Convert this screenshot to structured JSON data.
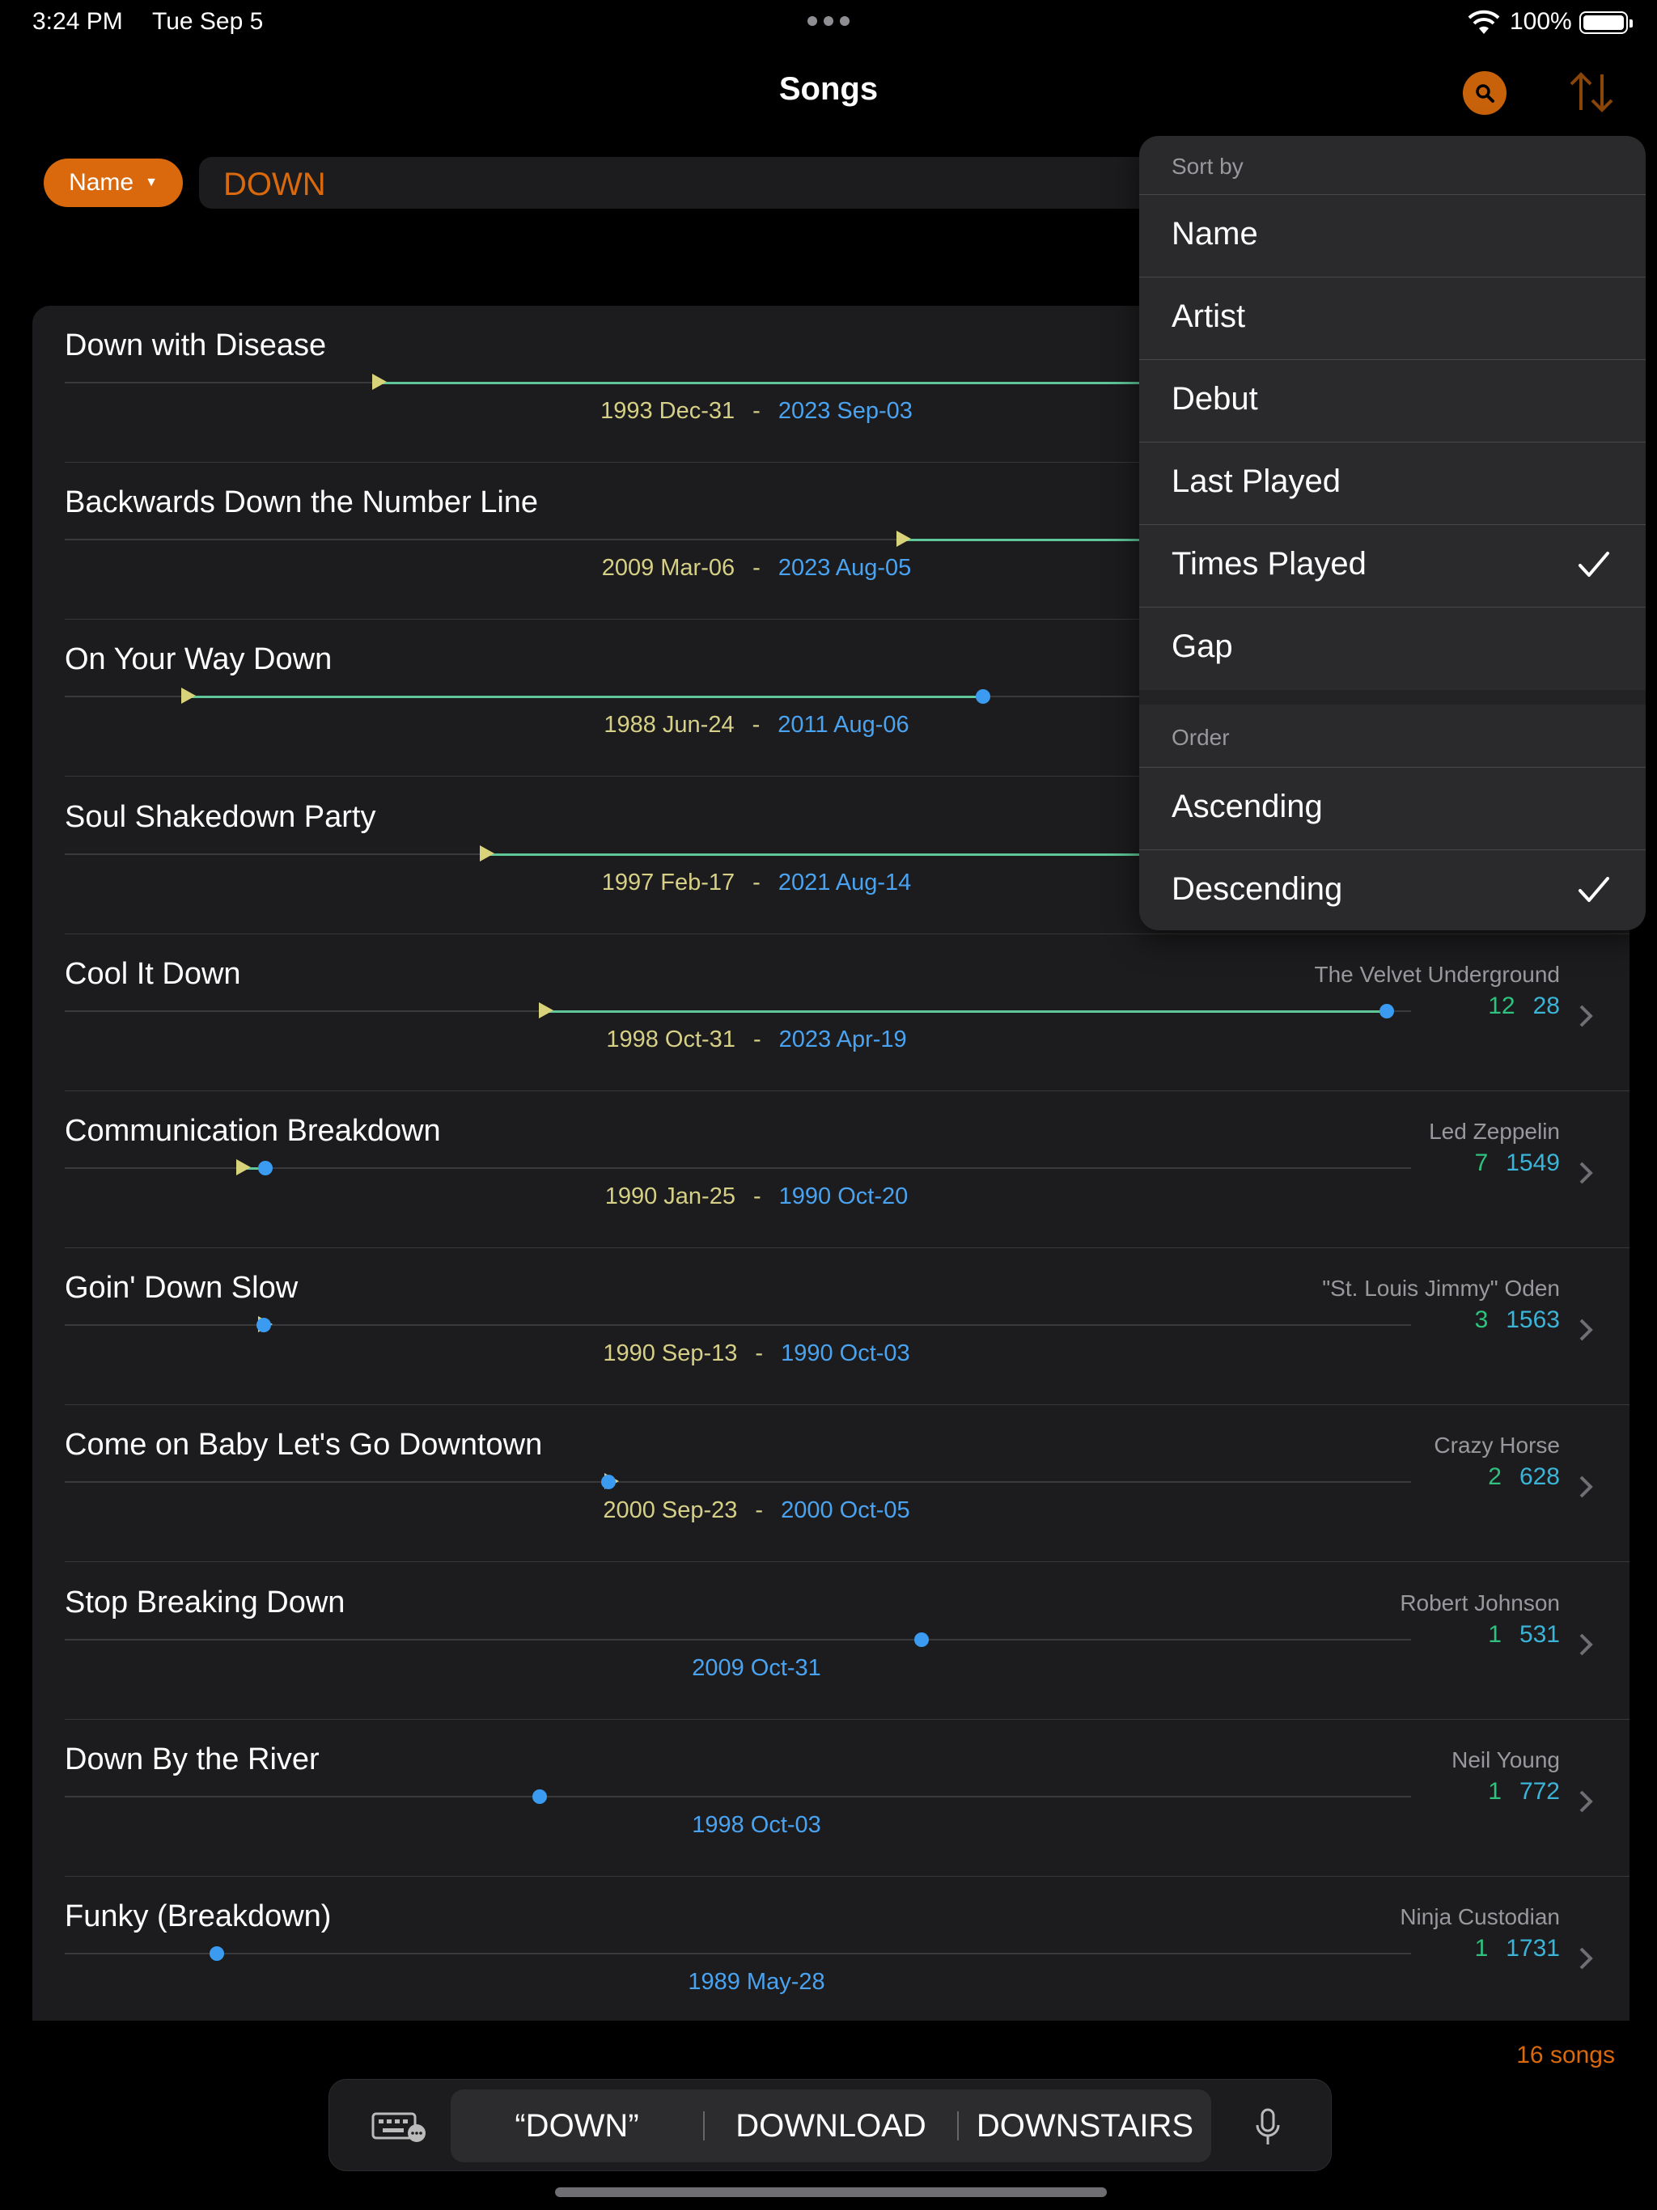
{
  "status": {
    "time": "3:24 PM",
    "date": "Tue Sep 5",
    "battery": "100%"
  },
  "nav": {
    "title": "Songs",
    "search_icon": "search-icon",
    "sort_icon": "sort-arrows-icon"
  },
  "filter": {
    "field_label": "Name",
    "query": "DOWN"
  },
  "songs": [
    {
      "title": "Down with Disease",
      "artist": "",
      "times": "",
      "gap": "",
      "debut": "1993 Dec-31",
      "last": "2023 Sep-03"
    },
    {
      "title": "Backwards Down the Number Line",
      "artist": "",
      "times": "",
      "gap": "",
      "debut": "2009 Mar-06",
      "last": "2023 Aug-05"
    },
    {
      "title": "On Your Way Down",
      "artist": "",
      "times": "",
      "gap": "",
      "debut": "1988 Jun-24",
      "last": "2011 Aug-06"
    },
    {
      "title": "Soul Shakedown Party",
      "artist": "",
      "times": "",
      "gap": "",
      "debut": "1997 Feb-17",
      "last": "2021 Aug-14"
    },
    {
      "title": "Cool It Down",
      "artist": "The Velvet Underground",
      "times": "12",
      "gap": "28",
      "debut": "1998 Oct-31",
      "last": "2023 Apr-19"
    },
    {
      "title": "Communication Breakdown",
      "artist": "Led Zeppelin",
      "times": "7",
      "gap": "1549",
      "debut": "1990 Jan-25",
      "last": "1990 Oct-20"
    },
    {
      "title": "Goin' Down Slow",
      "artist": "\"St. Louis Jimmy\" Oden",
      "times": "3",
      "gap": "1563",
      "debut": "1990 Sep-13",
      "last": "1990 Oct-03"
    },
    {
      "title": "Come on Baby Let's Go Downtown",
      "artist": "Crazy Horse",
      "times": "2",
      "gap": "628",
      "debut": "2000 Sep-23",
      "last": "2000 Oct-05"
    },
    {
      "title": "Stop Breaking Down",
      "artist": "Robert Johnson",
      "times": "1",
      "gap": "531",
      "debut": "",
      "last": "2009 Oct-31"
    },
    {
      "title": "Down By the River",
      "artist": "Neil Young",
      "times": "1",
      "gap": "772",
      "debut": "",
      "last": "1998 Oct-03"
    },
    {
      "title": "Funky (Breakdown)",
      "artist": "Ninja Custodian",
      "times": "1",
      "gap": "1731",
      "debut": "",
      "last": "1989 May-28"
    }
  ],
  "footer": {
    "count": "16 songs"
  },
  "keyboard": {
    "suggestions": [
      "“DOWN”",
      "DOWNLOAD",
      "DOWNSTAIRS"
    ]
  },
  "menu": {
    "sort_header": "Sort by",
    "sort_items": [
      {
        "label": "Name",
        "checked": false
      },
      {
        "label": "Artist",
        "checked": false
      },
      {
        "label": "Debut",
        "checked": false
      },
      {
        "label": "Last Played",
        "checked": false
      },
      {
        "label": "Times Played",
        "checked": true
      },
      {
        "label": "Gap",
        "checked": false
      }
    ],
    "order_header": "Order",
    "order_items": [
      {
        "label": "Ascending",
        "checked": false
      },
      {
        "label": "Descending",
        "checked": true
      }
    ]
  },
  "colors": {
    "accent": "#d9690c",
    "debut": "#d6cf86",
    "last_played": "#4aa3f0",
    "times": "#2ec27e",
    "gap": "#3cb4d8"
  }
}
